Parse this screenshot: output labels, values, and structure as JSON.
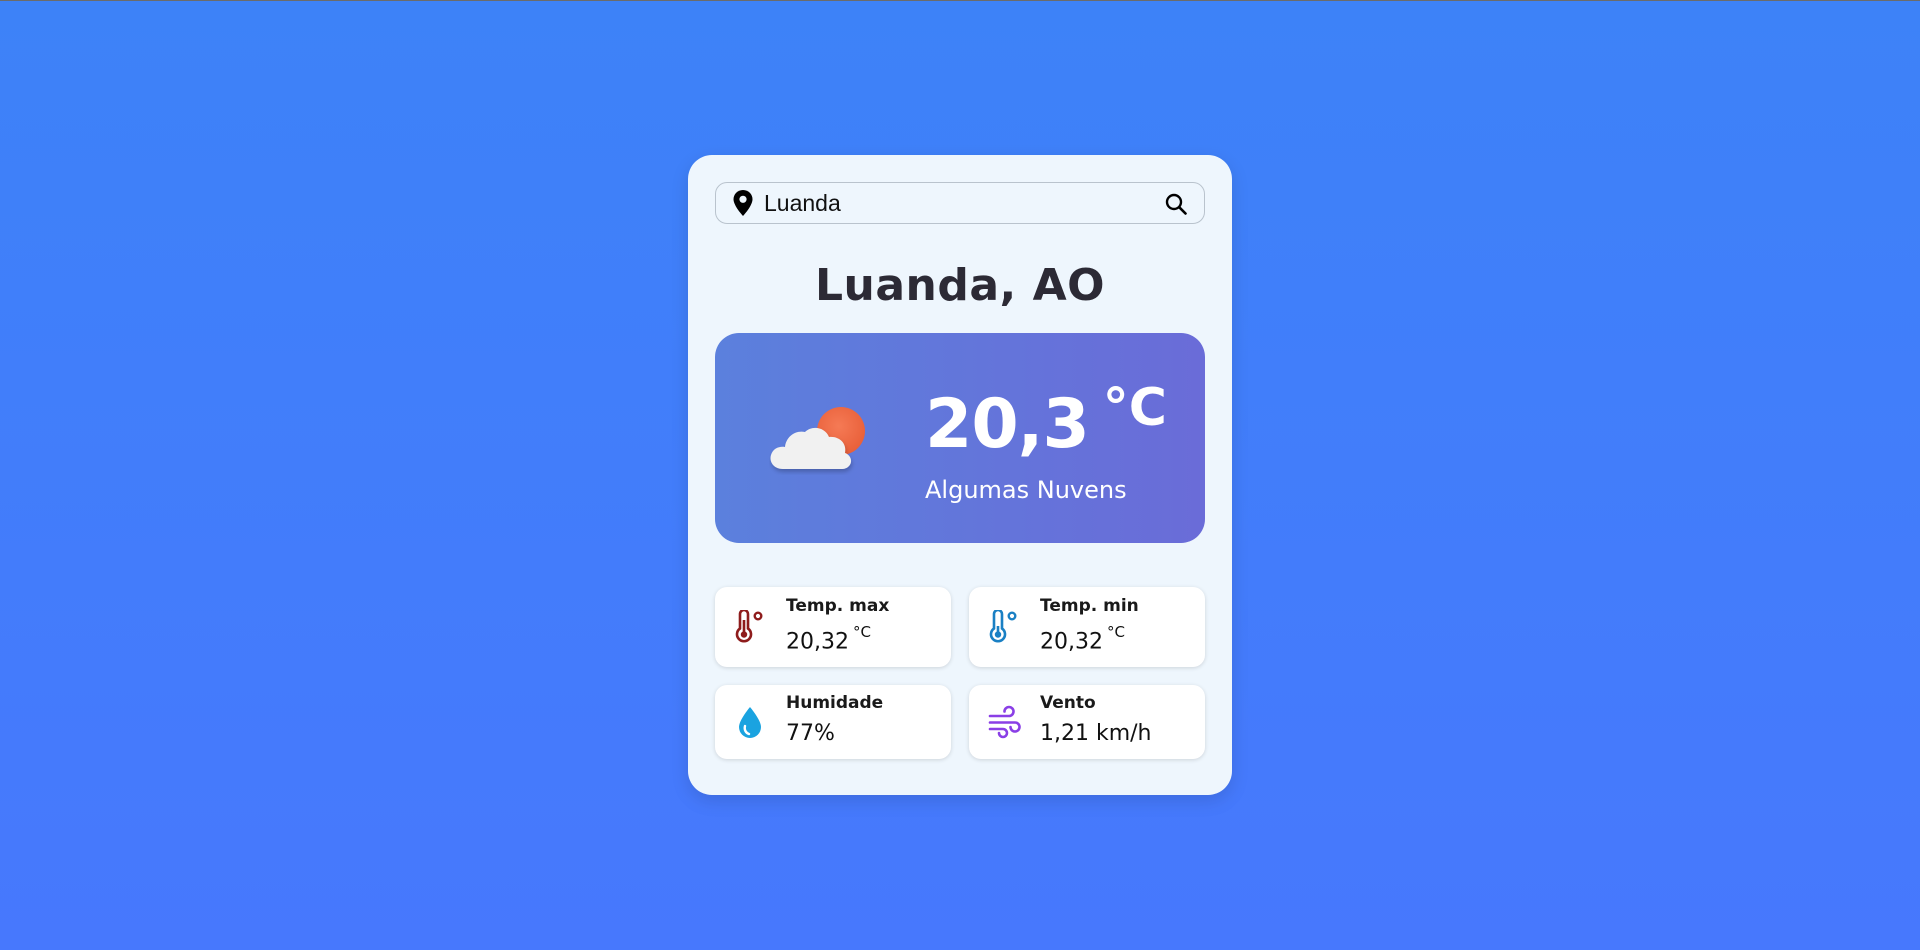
{
  "search": {
    "value": "Luanda",
    "icon_left": "map-pin-icon",
    "icon_right": "search-icon"
  },
  "location": {
    "city": "Luanda, AO"
  },
  "current": {
    "temp_value": "20,3",
    "temp_unit": "°C",
    "description": "Algumas Nuvens",
    "icon": "partly-cloudy-icon"
  },
  "stats": {
    "temp_max": {
      "label": "Temp. max",
      "value": "20,32",
      "unit": "°C",
      "icon": "thermometer-hot-icon",
      "color": "#8e1c1c"
    },
    "temp_min": {
      "label": "Temp. min",
      "value": "20,32",
      "unit": "°C",
      "icon": "thermometer-cold-icon",
      "color": "#1a80c4"
    },
    "humidity": {
      "label": "Humidade",
      "value": "77%",
      "icon": "water-drop-icon",
      "color": "#1aa3e0"
    },
    "wind": {
      "label": "Vento",
      "value": "1,21 km/h",
      "icon": "wind-icon",
      "color": "#8a3fe6"
    }
  },
  "colors": {
    "background": "#4180f9",
    "card": "#eef6fd",
    "hero_start": "#5b80dd",
    "hero_end": "#6a6cd8",
    "title": "#2c2a35"
  }
}
